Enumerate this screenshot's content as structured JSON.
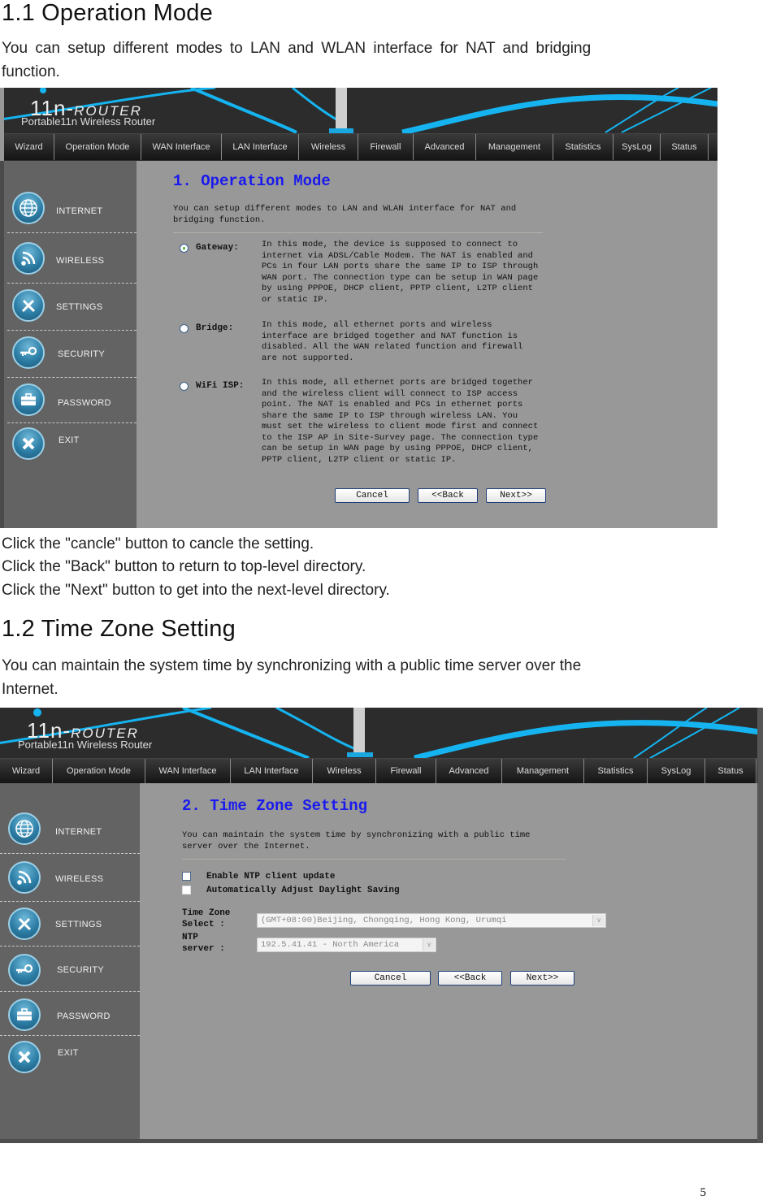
{
  "section1": {
    "heading": "1.1 Operation Mode",
    "intro_line1": "You can setup different modes to LAN and WLAN interface for NAT and bridging",
    "intro_line2": "function.",
    "notes": [
      "Click the   \"cancle\" button to cancle the setting.",
      "Click the \"Back\" button to return to top-level directory.",
      "Click the \"Next\" button to get into the next-level directory."
    ]
  },
  "section2": {
    "heading": "1.2 Time Zone Setting",
    "intro_line1": "You can maintain the system time by synchronizing with a public time server over the",
    "intro_line2": "Internet."
  },
  "router": {
    "logo_main_n": "11n-",
    "logo_main_r": "ROUTER",
    "logo_sub": "Portable11n Wireless Router",
    "nav": [
      "Wizard",
      "Operation Mode",
      "WAN Interface",
      "LAN Interface",
      "Wireless",
      "Firewall",
      "Advanced",
      "Management",
      "Statistics",
      "SysLog",
      "Status"
    ],
    "sidebar": [
      {
        "label": "INTERNET",
        "icon": "globe-icon"
      },
      {
        "label": "WIRELESS",
        "icon": "wifi-icon"
      },
      {
        "label": "SETTINGS",
        "icon": "tools-icon"
      },
      {
        "label": "SECURITY",
        "icon": "key-icon"
      },
      {
        "label": "PASSWORD",
        "icon": "toolbox-icon"
      },
      {
        "label": "EXIT",
        "icon": "close-icon"
      }
    ],
    "buttons": {
      "cancel": "Cancel",
      "back": "<<Back",
      "next": "Next>>"
    }
  },
  "screen1": {
    "title": "1.  Operation Mode",
    "desc": "You can setup different modes to LAN and WLAN interface for NAT and\nbridging function.",
    "modes": [
      {
        "label": "Gateway:",
        "selected": true,
        "desc": "In this mode, the device is supposed to connect to\ninternet via ADSL/Cable Modem. The NAT is enabled and\nPCs in four LAN ports share the same IP to ISP through\nWAN port. The connection type can be setup in WAN page\nby using PPPOE, DHCP client, PPTP client, L2TP client\nor static IP."
      },
      {
        "label": "Bridge:",
        "selected": false,
        "desc": "In this mode, all ethernet ports and wireless\ninterface are bridged together and NAT function is\ndisabled. All the WAN related function and firewall\nare not supported."
      },
      {
        "label": "WiFi ISP:",
        "selected": false,
        "desc": "In this mode, all ethernet ports are bridged together\nand the wireless client will connect to ISP access\npoint. The NAT is enabled and PCs in ethernet ports\nshare the same IP to ISP through wireless LAN. You\nmust set the wireless to client mode first and connect\nto the ISP AP in Site-Survey page. The connection type\ncan be setup in WAN page by using PPPOE, DHCP client,\nPPTP client, L2TP client or static IP."
      }
    ]
  },
  "screen2": {
    "title": "2.  Time Zone Setting",
    "desc": "You can maintain the system time by synchronizing with a public time\nserver over the Internet.",
    "enable_ntp_label": "Enable NTP client update",
    "enable_ntp_checked": false,
    "dst_label": "Automatically Adjust Daylight Saving",
    "dst_checked": false,
    "tz_label": "Time Zone\nSelect :",
    "tz_value": "(GMT+08:00)Beijing, Chongqing, Hong Kong, Urumqi",
    "ntp_label": "NTP\nserver :",
    "ntp_value": "192.5.41.41 - North America"
  },
  "page_number": "5"
}
